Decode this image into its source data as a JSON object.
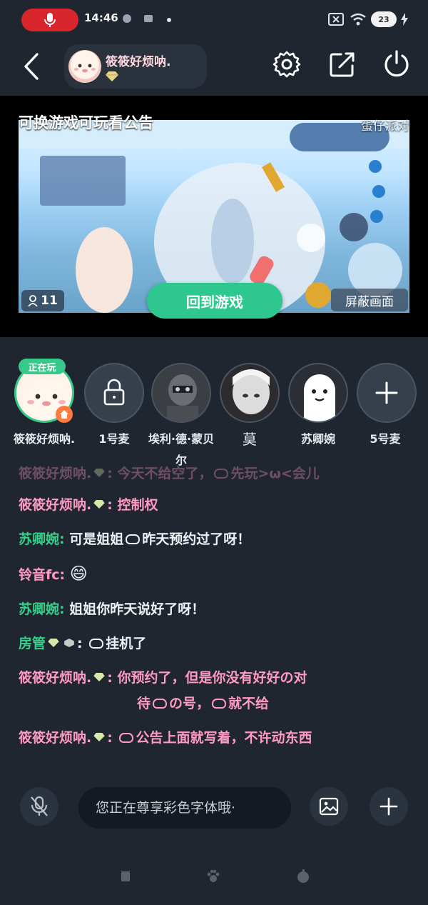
{
  "status_bar": {
    "time": "14:46",
    "battery": "23",
    "icons": [
      "mic-recording-icon",
      "app-notify-icon",
      "app-notify-icon-2",
      "dot-icon",
      "screen-cast-icon",
      "wifi-icon",
      "battery-icon",
      "charging-icon"
    ]
  },
  "header": {
    "host_name": "筱筱好烦呐.",
    "icons": [
      "back-icon",
      "gear-icon",
      "share-icon",
      "power-icon"
    ]
  },
  "video": {
    "title": "可换游戏可玩看公告",
    "game_name": "蛋仔派对",
    "viewer_count": "11",
    "back_to_game": "回到游戏",
    "block_screen": "屏蔽画面"
  },
  "seats": [
    {
      "label": "筱筱好烦呐.",
      "tag": "正在玩",
      "type": "host"
    },
    {
      "label": "1号麦",
      "type": "locked"
    },
    {
      "label": "埃利·德·蒙贝尔",
      "type": "avatar"
    },
    {
      "label": "莫",
      "type": "avatar"
    },
    {
      "label": "苏卿婉",
      "type": "avatar"
    },
    {
      "label": "5号麦",
      "type": "add"
    }
  ],
  "chat": {
    "messages": [
      {
        "name": "筱筱好烦呐.",
        "text": "今天不给空了，",
        "text2": "先玩>ω<会儿"
      },
      {
        "name": "筱筱好烦呐.",
        "text": "控制权"
      },
      {
        "name": "苏卿婉:",
        "text": "可是姐姐",
        "text2": "昨天预约过了呀！"
      },
      {
        "name": "铃音fc:",
        "text": "😄"
      },
      {
        "name": "苏卿婉:",
        "text": "姐姐你昨天说好了呀！"
      },
      {
        "name": "房管",
        "text": "挂机了"
      },
      {
        "name": "筱筱好烦呐.",
        "text": "你预约了，但是你没有好好の对",
        "line2a": "待",
        "line2b": "の号，",
        "line2c": "就不给"
      },
      {
        "name": "筱筱好烦呐.",
        "text": "公告上面就写着，不许动东西"
      }
    ]
  },
  "input": {
    "placeholder": "您正在尊享彩色字体哦·"
  },
  "colors": {
    "pink_name": "#ff9ac0",
    "green_name": "#36d08a",
    "accent_green": "#2ec78f",
    "record_red": "#d8262c"
  }
}
